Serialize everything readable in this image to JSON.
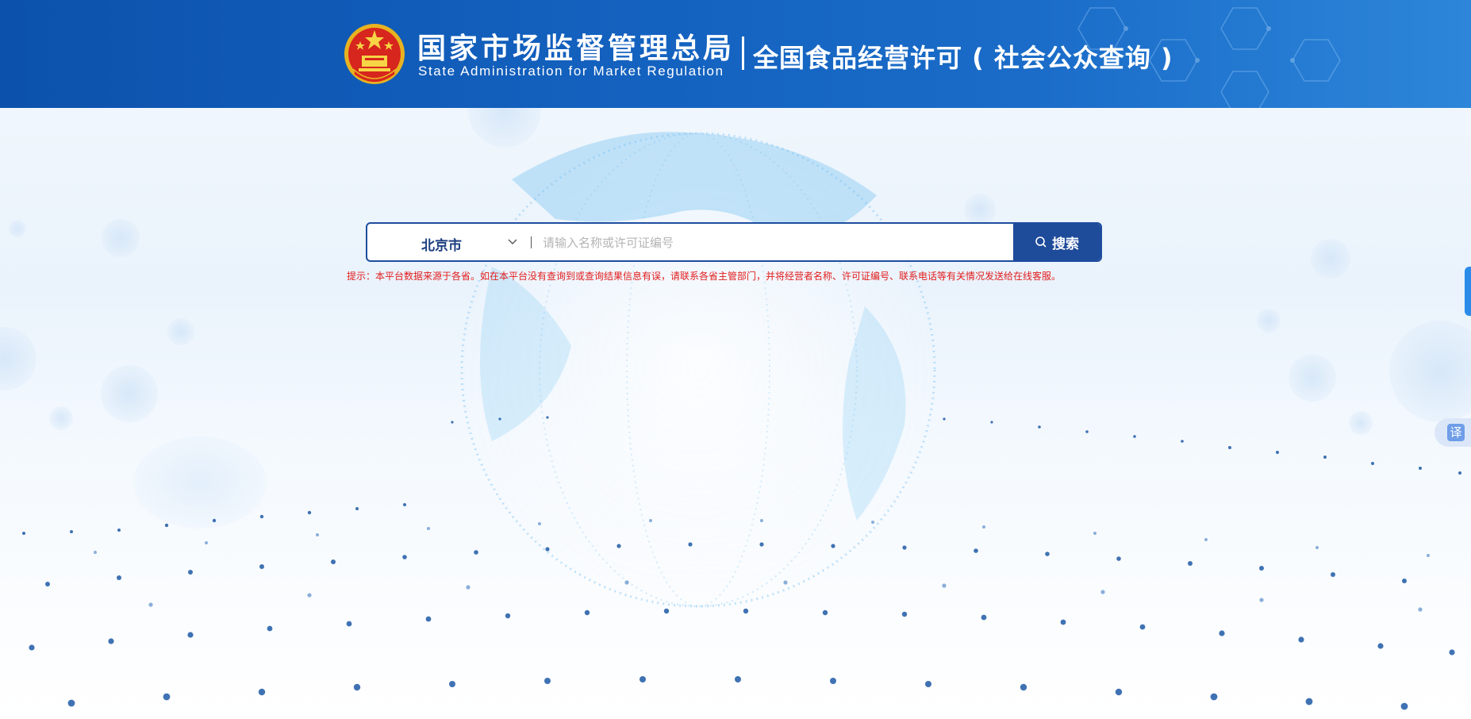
{
  "header": {
    "org_name_cn": "国家市场监督管理总局",
    "org_name_en": "State Administration  for  Market Regulation",
    "site_title": "全国食品经营许可 ( 社会公众查询 )"
  },
  "search": {
    "region_selected": "北京市",
    "placeholder": "请输入名称或许可证编号",
    "value": "",
    "button_label": "搜索",
    "hint": "提示：本平台数据来源于各省。如在本平台没有查询到或查询结果信息有误，请联系各省主管部门，并将经营者名称、许可证编号、联系电话等有关情况发送给在线客服。"
  },
  "side": {
    "translate_label": "译"
  },
  "colors": {
    "header_blue": "#0c52ac",
    "search_border": "#1d4d9e",
    "button_blue": "#1e4b9a",
    "hint_red": "#e21c1c"
  },
  "icons": [
    "national-emblem",
    "chevron-down-icon",
    "search-icon",
    "translate-icon"
  ]
}
